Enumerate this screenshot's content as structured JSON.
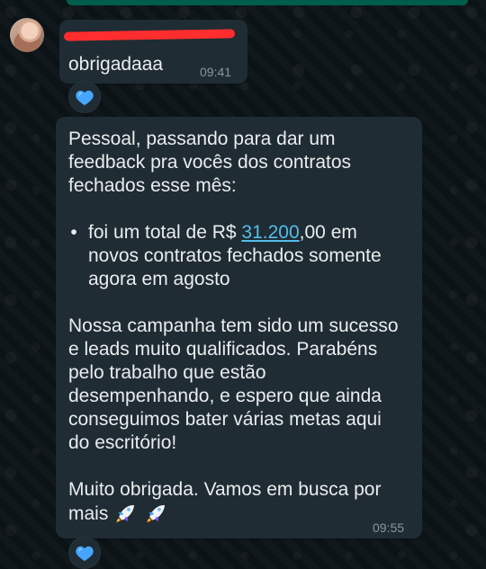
{
  "chat": {
    "messages": [
      {
        "sender_redacted": "",
        "text": "obrigadaaa",
        "time": "09:41",
        "reaction": "blue-heart-icon"
      },
      {
        "paragraph_1": "Pessoal, passando para dar um feedback pra vocês dos contratos fechados esse mês:",
        "bullet_prefix": "foi um total de R$ ",
        "amount_link": "31.200",
        "amount_suffix": ",00",
        "bullet_after": " em novos contratos fechados somente agora em agosto",
        "paragraph_3": "Nossa campanha tem sido um sucesso e leads muito qualificados. Parabéns pelo trabalho que estão desempenhando, e espero que ainda conseguimos bater várias metas aqui do escritório!",
        "paragraph_4": "Muito obrigada. Vamos em busca por mais",
        "time": "09:55",
        "reaction": "blue-heart-icon"
      }
    ]
  },
  "colors": {
    "background": "#0c1317",
    "bubble": "#202c33",
    "text": "#e9edef",
    "meta": "#8696a0",
    "link": "#53bdeb",
    "redaction": "#ff2d2d",
    "heart": "#46a6ff"
  }
}
